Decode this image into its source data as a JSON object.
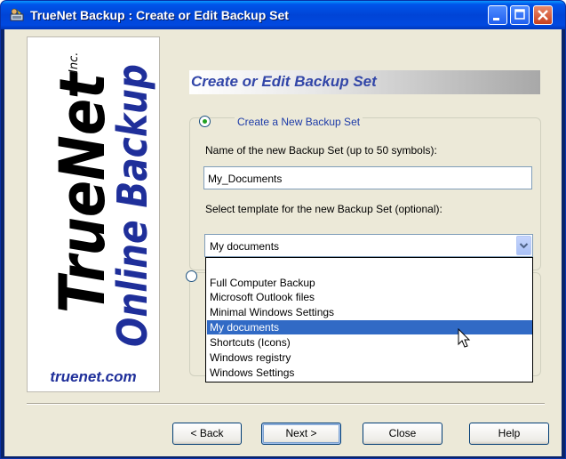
{
  "window": {
    "title": "TrueNet Backup : Create or Edit Backup Set"
  },
  "logo": {
    "url_text": "truenet.com",
    "brand_text": "TrueNet Inc.",
    "tagline": "Online Backup"
  },
  "heading": "Create or Edit Backup Set",
  "new_set": {
    "radio_label": "Create a New Backup Set",
    "name_label": "Name of the new Backup Set (up to 50 symbols):",
    "name_value": "My_Documents",
    "template_label": "Select template for the new Backup Set (optional):",
    "template_selected": "My documents"
  },
  "dropdown": {
    "options": [
      "Full Computer Backup",
      "Microsoft Outlook files",
      "Minimal Windows Settings",
      "My documents",
      "Shortcuts (Icons)",
      "Windows registry",
      "Windows Settings"
    ],
    "highlighted": "My documents"
  },
  "buttons": {
    "back": "< Back",
    "next": "Next >",
    "close": "Close",
    "help": "Help"
  }
}
